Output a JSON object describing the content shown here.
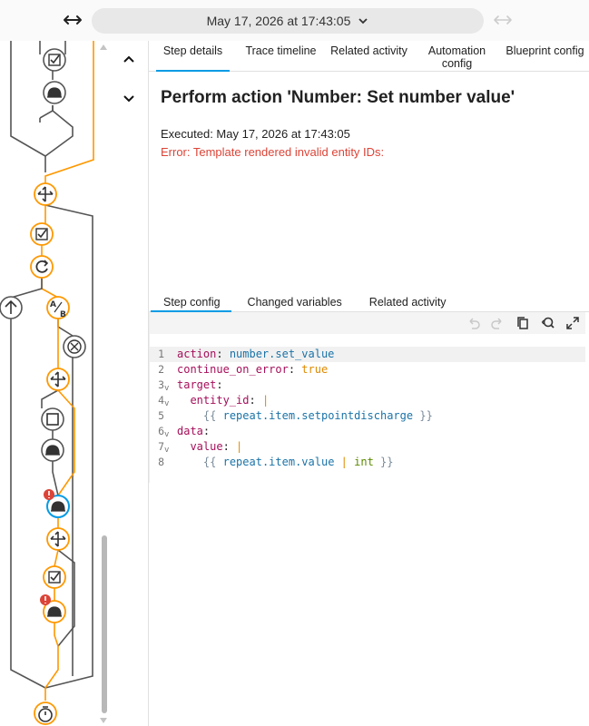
{
  "header": {
    "date_label": "May 17, 2026 at 17:43:05"
  },
  "tabs": [
    {
      "label": "Step details"
    },
    {
      "label": "Trace timeline"
    },
    {
      "label": "Related activity"
    },
    {
      "label": "Automation config"
    },
    {
      "label": "Blueprint config"
    }
  ],
  "step": {
    "title": "Perform action 'Number: Set number value'",
    "executed": "Executed: May 17, 2026 at 17:43:05",
    "error": "Error: Template rendered invalid entity IDs:"
  },
  "subtabs": [
    {
      "label": "Step config"
    },
    {
      "label": "Changed variables"
    },
    {
      "label": "Related activity"
    }
  ],
  "code": {
    "line_numbers": [
      "1",
      "2",
      "3",
      "4",
      "5",
      "6",
      "7",
      "8"
    ],
    "l1_key": "action",
    "l1_val": "number.set_value",
    "l2_key": "continue_on_error",
    "l2_val": "true",
    "l3_key": "target",
    "l4_key": "entity_id",
    "l4_pipe": "|",
    "l5_open": "{{",
    "l5_expr": "repeat.item.setpointdischarge",
    "l5_close": "}}",
    "l6_key": "data",
    "l7_key": "value",
    "l7_pipe": "|",
    "l8_open": "{{",
    "l8_expr": "repeat.item.value",
    "l8_pipe": "|",
    "l8_filter": "int",
    "l8_close": "}}"
  },
  "colors": {
    "accent": "#039be5",
    "active_path": "#ff9800",
    "error": "#db4437",
    "selected_node": "#039be5"
  },
  "icons": {
    "back": "arrow-left-right-icon",
    "date_dropdown": "chevron-down-icon",
    "forward": "arrow-left-right-icon",
    "prev_step": "chevron-up-icon",
    "next_step": "chevron-down-icon"
  }
}
